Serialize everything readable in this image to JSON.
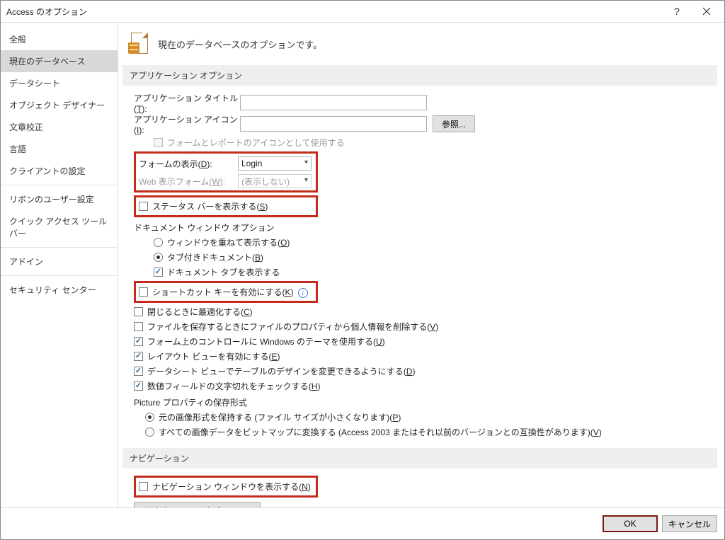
{
  "title": "Access のオプション",
  "sidebar": {
    "items": [
      "全般",
      "現在のデータベース",
      "データシート",
      "オブジェクト デザイナー",
      "文章校正",
      "言語",
      "クライアントの設定"
    ],
    "items2": [
      "リボンのユーザー設定",
      "クイック アクセス ツール バー"
    ],
    "items3": [
      "アドイン"
    ],
    "items4": [
      "セキュリティ センター"
    ],
    "selected_index": 1
  },
  "header_text": "現在のデータベースのオプションです。",
  "sections": {
    "app": {
      "title": "アプリケーション オプション",
      "app_title_label": "アプリケーション タイトル(",
      "app_title_key": "T",
      "app_title_value": "",
      "app_icon_label": "アプリケーション アイコン(",
      "app_icon_key": "I",
      "app_icon_value": "",
      "browse": "参照...",
      "use_as_icon": "フォームとレポートのアイコンとして使用する",
      "form_display_label": "フォームの表示(",
      "form_display_key": "D",
      "form_display_value": "Login",
      "web_display_label": "Web 表示フォーム(",
      "web_display_key": "W",
      "web_display_value": "(表示しない)",
      "status_bar": "ステータス バーを表示する(",
      "status_bar_key": "S",
      "doc_window_title": "ドキュメント ウィンドウ オプション",
      "overlap": "ウィンドウを重ねて表示する(",
      "overlap_key": "O",
      "tabbed": "タブ付きドキュメント(",
      "tabbed_key": "B",
      "show_doc_tabs": "ドキュメント タブを表示する",
      "shortcut_keys": "ショートカット キーを有効にする(",
      "shortcut_keys_key": "K",
      "compact_on_close": "閉じるときに最適化する(",
      "compact_on_close_key": "C",
      "remove_personal": "ファイルを保存するときにファイルのプロパティから個人情報を削除する(",
      "remove_personal_key": "V",
      "use_themed": "フォーム上のコントロールに Windows のテーマを使用する(",
      "use_themed_key": "U",
      "enable_layout": "レイアウト ビューを有効にする(",
      "enable_layout_key": "E",
      "enable_design": "データシート ビューでテーブルのデザインを変更できるようにする(",
      "enable_design_key": "D",
      "check_trunc": "数値フィールドの文字切れをチェックする(",
      "check_trunc_key": "H",
      "picture_title": "Picture プロパティの保存形式",
      "picture_src": "元の画像形式を保持する (ファイル サイズが小さくなります)(",
      "picture_src_key": "P",
      "picture_bmp": "すべての画像データをビットマップに変換する (Access 2003 またはそれ以前のバージョンとの互換性があります)(",
      "picture_bmp_key": "V"
    },
    "nav": {
      "title": "ナビゲーション",
      "show_nav": "ナビゲーション ウィンドウを表示する(",
      "show_nav_key": "N",
      "nav_options": "ナビゲーション オプション..."
    }
  },
  "footer": {
    "ok": "OK",
    "cancel": "キャンセル"
  }
}
